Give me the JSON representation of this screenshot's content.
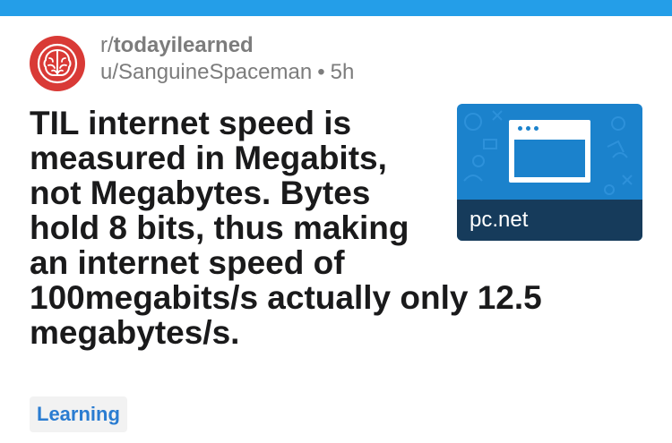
{
  "header": {
    "accent_color": "#249ee8"
  },
  "post": {
    "subreddit_prefix": "r/",
    "subreddit_name": "todayilearned",
    "author": "u/SanguineSpaceman",
    "separator": "•",
    "age": "5h",
    "avatar_icon": "brain-icon",
    "title": "TIL internet speed is measured in Megabits, not Megabytes. Bytes hold 8 bits, thus making an internet speed of 100megabits/s actually only 12.5 megabytes/s.",
    "flair": "Learning"
  },
  "thumbnail": {
    "domain": "pc.net",
    "icon": "browser-window-icon"
  }
}
